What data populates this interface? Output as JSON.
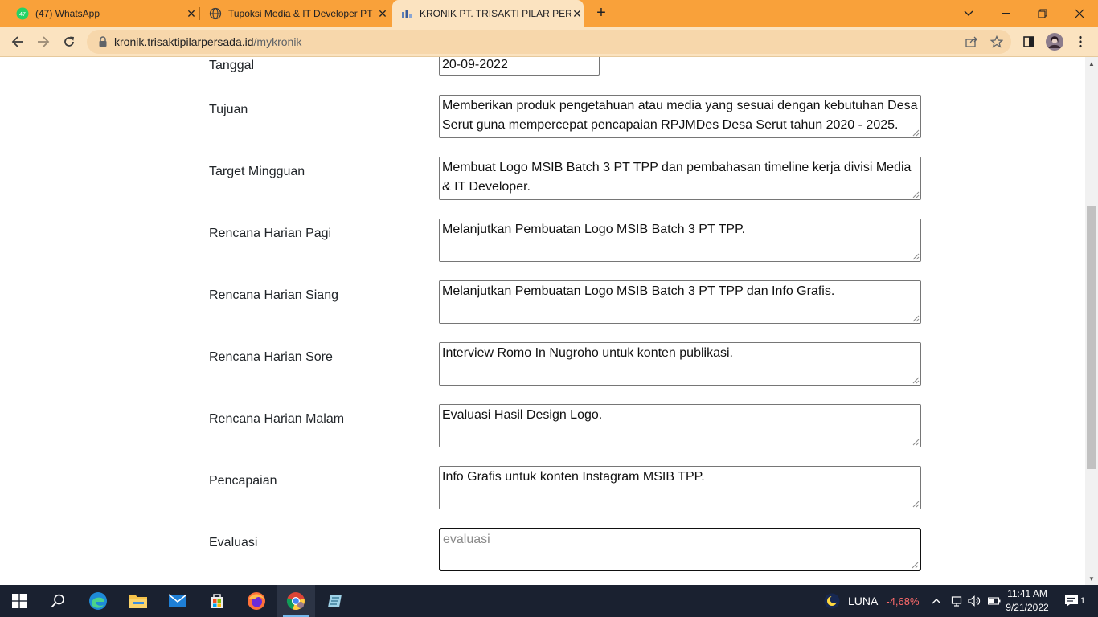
{
  "browser": {
    "tabs": [
      {
        "title": "(47) WhatsApp",
        "badge": "47",
        "icon": "whatsapp-icon"
      },
      {
        "title": "Tupoksi Media & IT Developer PT",
        "icon": "globe-icon"
      },
      {
        "title": "KRONIK PT. TRISAKTI PILAR PERSA",
        "icon": "site-favicon-icon"
      }
    ],
    "url_domain": "kronik.trisaktipilarpersada.id",
    "url_path": "/mykronik",
    "accent_color": "#f9a13a"
  },
  "form": {
    "rows": [
      {
        "label": "Tanggal",
        "value": "20-09-2022",
        "type": "date"
      },
      {
        "label": "Tujuan",
        "value": "Memberikan produk pengetahuan atau media yang sesuai dengan kebutuhan Desa Serut guna mempercepat pencapaian RPJMDes Desa Serut tahun 2020 - 2025."
      },
      {
        "label": "Target Mingguan",
        "value": "Membuat Logo MSIB Batch 3 PT TPP dan pembahasan timeline kerja divisi Media & IT Developer."
      },
      {
        "label": "Rencana Harian Pagi",
        "value": "Melanjutkan Pembuatan Logo MSIB Batch 3 PT TPP."
      },
      {
        "label": "Rencana Harian Siang",
        "value": "Melanjutkan Pembuatan Logo MSIB Batch 3 PT TPP dan Info Grafis."
      },
      {
        "label": "Rencana Harian Sore",
        "value": "Interview Romo In Nugroho untuk konten publikasi."
      },
      {
        "label": "Rencana Harian Malam",
        "value": "Evaluasi Hasil Design Logo."
      },
      {
        "label": "Pencapaian",
        "value": "Info Grafis untuk konten Instagram MSIB TPP."
      },
      {
        "label": "Evaluasi",
        "value": "",
        "placeholder": "evaluasi"
      }
    ]
  },
  "taskbar": {
    "ticker_name": "LUNA",
    "ticker_change": "-4,68%",
    "time": "11:41 AM",
    "date": "9/21/2022",
    "notification_count": "1"
  }
}
